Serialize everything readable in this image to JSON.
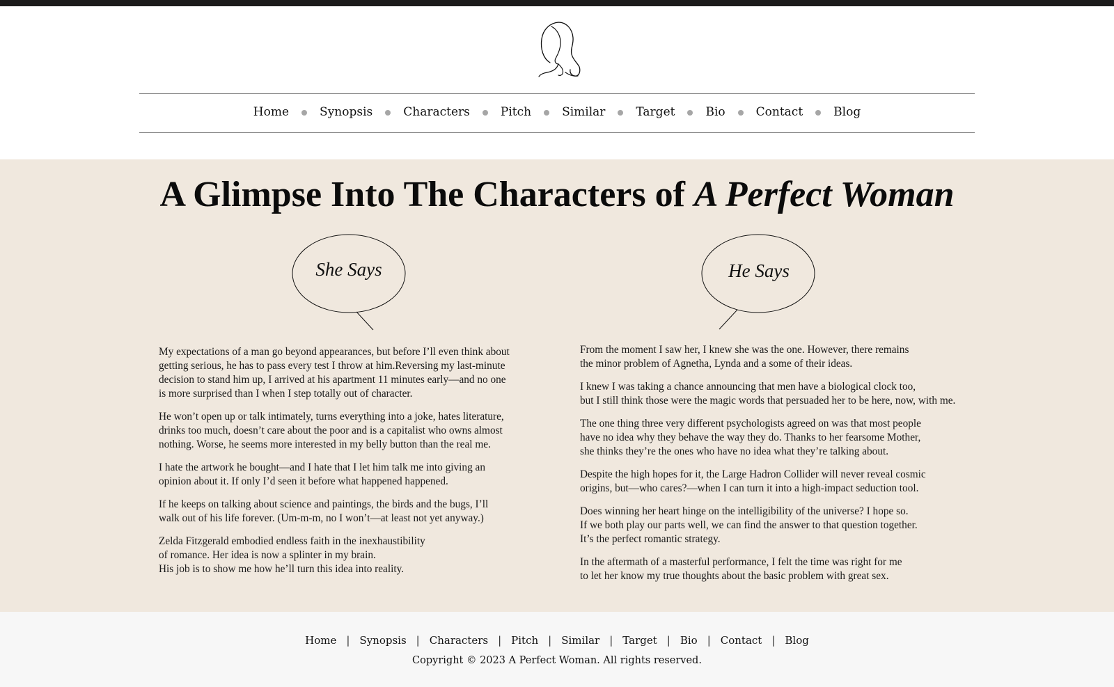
{
  "nav": {
    "items": [
      "Home",
      "Synopsis",
      "Characters",
      "Pitch",
      "Similar",
      "Target",
      "Bio",
      "Contact",
      "Blog"
    ]
  },
  "main": {
    "title_prefix": "A Glimpse Into The Characters of",
    "title_emphasis": "A Perfect Woman",
    "she": {
      "heading": "She Says",
      "paragraphs": [
        [
          "My expectations of a man go beyond appearances, but before I’ll even think about",
          "getting serious, he has to pass every test I throw at him.Reversing my last-minute",
          "decision to stand him up, I arrived at his apartment 11 minutes early—and no one",
          "is more surprised than I when I step totally out of character."
        ],
        [
          "He won’t open up or talk intimately, turns everything into a joke, hates literature,",
          "drinks too much, doesn’t care about the poor and is a capitalist who owns almost",
          "nothing. Worse, he seems more interested in my belly button than the real me."
        ],
        [
          "I hate the artwork he bought—and I hate that I let him talk me into giving an",
          "opinion about it. If only I’d seen it before what happened happened."
        ],
        [
          "If he keeps on talking about science and paintings, the birds and the bugs, I’ll",
          "walk out of his life forever. (Um-m-m, no I won’t—at least not yet anyway.)"
        ],
        [
          "Zelda Fitzgerald embodied endless faith in the inexhaustibility",
          "of romance. Her idea is now a splinter in my brain.",
          "His job is to show me how he’ll turn this idea into reality."
        ]
      ]
    },
    "he": {
      "heading": "He Says",
      "paragraphs": [
        [
          "From the moment I saw her, I knew she was the one. However, there remains",
          "the minor problem of Agnetha, Lynda and a some of their ideas."
        ],
        [
          "I knew I was taking a chance announcing that men have a biological clock too,",
          "but I still think those were the magic words that persuaded her to be here, now, with me."
        ],
        [
          "The one thing three very different psychologists agreed on was that most people",
          "have no idea why they behave the way they do. Thanks to her fearsome Mother,",
          "she thinks they’re the ones who have no idea what they’re talking about."
        ],
        [
          "Despite the high hopes for it, the Large Hadron Collider will never reveal cosmic",
          "origins, but—who cares?—when I can turn it into a high-impact seduction tool."
        ],
        [
          "Does winning her heart hinge on the intelligibility of the universe? I hope so.",
          "If we both play our parts well, we can find the answer to that question together.",
          "It’s the perfect romantic strategy."
        ],
        [
          "In the aftermath of a masterful performance, I felt the time was right for me",
          "to let her know my true thoughts about the basic problem with great sex."
        ]
      ]
    }
  },
  "footer": {
    "items": [
      "Home",
      "Synopsis",
      "Characters",
      "Pitch",
      "Similar",
      "Target",
      "Bio",
      "Contact",
      "Blog"
    ],
    "separator": "|",
    "copyright": "Copyright © 2023 A Perfect Woman. All rights reserved."
  }
}
